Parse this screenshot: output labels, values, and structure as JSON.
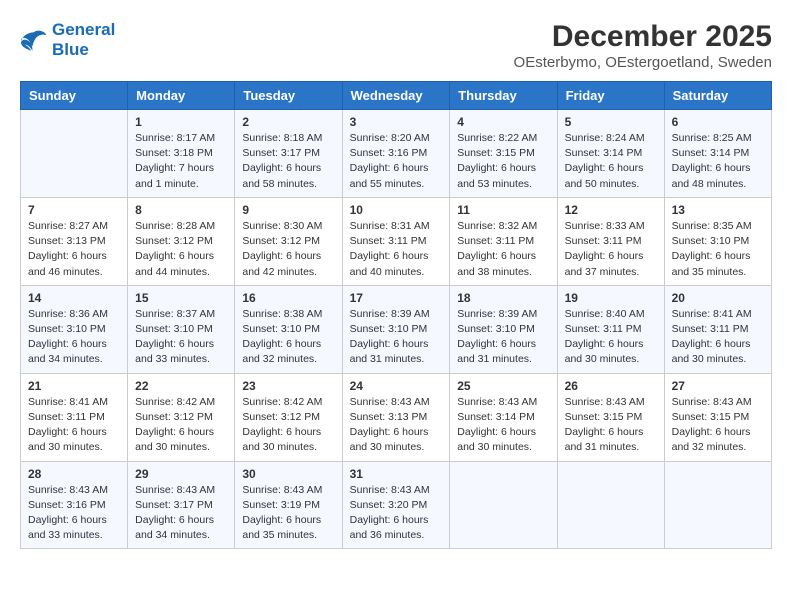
{
  "header": {
    "logo_line1": "General",
    "logo_line2": "Blue",
    "month_year": "December 2025",
    "location": "OEsterbymo, OEstergoetland, Sweden"
  },
  "weekdays": [
    "Sunday",
    "Monday",
    "Tuesday",
    "Wednesday",
    "Thursday",
    "Friday",
    "Saturday"
  ],
  "rows": [
    [
      {
        "day": "",
        "content": ""
      },
      {
        "day": "1",
        "content": "Sunrise: 8:17 AM\nSunset: 3:18 PM\nDaylight: 7 hours\nand 1 minute."
      },
      {
        "day": "2",
        "content": "Sunrise: 8:18 AM\nSunset: 3:17 PM\nDaylight: 6 hours\nand 58 minutes."
      },
      {
        "day": "3",
        "content": "Sunrise: 8:20 AM\nSunset: 3:16 PM\nDaylight: 6 hours\nand 55 minutes."
      },
      {
        "day": "4",
        "content": "Sunrise: 8:22 AM\nSunset: 3:15 PM\nDaylight: 6 hours\nand 53 minutes."
      },
      {
        "day": "5",
        "content": "Sunrise: 8:24 AM\nSunset: 3:14 PM\nDaylight: 6 hours\nand 50 minutes."
      },
      {
        "day": "6",
        "content": "Sunrise: 8:25 AM\nSunset: 3:14 PM\nDaylight: 6 hours\nand 48 minutes."
      }
    ],
    [
      {
        "day": "7",
        "content": "Sunrise: 8:27 AM\nSunset: 3:13 PM\nDaylight: 6 hours\nand 46 minutes."
      },
      {
        "day": "8",
        "content": "Sunrise: 8:28 AM\nSunset: 3:12 PM\nDaylight: 6 hours\nand 44 minutes."
      },
      {
        "day": "9",
        "content": "Sunrise: 8:30 AM\nSunset: 3:12 PM\nDaylight: 6 hours\nand 42 minutes."
      },
      {
        "day": "10",
        "content": "Sunrise: 8:31 AM\nSunset: 3:11 PM\nDaylight: 6 hours\nand 40 minutes."
      },
      {
        "day": "11",
        "content": "Sunrise: 8:32 AM\nSunset: 3:11 PM\nDaylight: 6 hours\nand 38 minutes."
      },
      {
        "day": "12",
        "content": "Sunrise: 8:33 AM\nSunset: 3:11 PM\nDaylight: 6 hours\nand 37 minutes."
      },
      {
        "day": "13",
        "content": "Sunrise: 8:35 AM\nSunset: 3:10 PM\nDaylight: 6 hours\nand 35 minutes."
      }
    ],
    [
      {
        "day": "14",
        "content": "Sunrise: 8:36 AM\nSunset: 3:10 PM\nDaylight: 6 hours\nand 34 minutes."
      },
      {
        "day": "15",
        "content": "Sunrise: 8:37 AM\nSunset: 3:10 PM\nDaylight: 6 hours\nand 33 minutes."
      },
      {
        "day": "16",
        "content": "Sunrise: 8:38 AM\nSunset: 3:10 PM\nDaylight: 6 hours\nand 32 minutes."
      },
      {
        "day": "17",
        "content": "Sunrise: 8:39 AM\nSunset: 3:10 PM\nDaylight: 6 hours\nand 31 minutes."
      },
      {
        "day": "18",
        "content": "Sunrise: 8:39 AM\nSunset: 3:10 PM\nDaylight: 6 hours\nand 31 minutes."
      },
      {
        "day": "19",
        "content": "Sunrise: 8:40 AM\nSunset: 3:11 PM\nDaylight: 6 hours\nand 30 minutes."
      },
      {
        "day": "20",
        "content": "Sunrise: 8:41 AM\nSunset: 3:11 PM\nDaylight: 6 hours\nand 30 minutes."
      }
    ],
    [
      {
        "day": "21",
        "content": "Sunrise: 8:41 AM\nSunset: 3:11 PM\nDaylight: 6 hours\nand 30 minutes."
      },
      {
        "day": "22",
        "content": "Sunrise: 8:42 AM\nSunset: 3:12 PM\nDaylight: 6 hours\nand 30 minutes."
      },
      {
        "day": "23",
        "content": "Sunrise: 8:42 AM\nSunset: 3:12 PM\nDaylight: 6 hours\nand 30 minutes."
      },
      {
        "day": "24",
        "content": "Sunrise: 8:43 AM\nSunset: 3:13 PM\nDaylight: 6 hours\nand 30 minutes."
      },
      {
        "day": "25",
        "content": "Sunrise: 8:43 AM\nSunset: 3:14 PM\nDaylight: 6 hours\nand 30 minutes."
      },
      {
        "day": "26",
        "content": "Sunrise: 8:43 AM\nSunset: 3:15 PM\nDaylight: 6 hours\nand 31 minutes."
      },
      {
        "day": "27",
        "content": "Sunrise: 8:43 AM\nSunset: 3:15 PM\nDaylight: 6 hours\nand 32 minutes."
      }
    ],
    [
      {
        "day": "28",
        "content": "Sunrise: 8:43 AM\nSunset: 3:16 PM\nDaylight: 6 hours\nand 33 minutes."
      },
      {
        "day": "29",
        "content": "Sunrise: 8:43 AM\nSunset: 3:17 PM\nDaylight: 6 hours\nand 34 minutes."
      },
      {
        "day": "30",
        "content": "Sunrise: 8:43 AM\nSunset: 3:19 PM\nDaylight: 6 hours\nand 35 minutes."
      },
      {
        "day": "31",
        "content": "Sunrise: 8:43 AM\nSunset: 3:20 PM\nDaylight: 6 hours\nand 36 minutes."
      },
      {
        "day": "",
        "content": ""
      },
      {
        "day": "",
        "content": ""
      },
      {
        "day": "",
        "content": ""
      }
    ]
  ]
}
